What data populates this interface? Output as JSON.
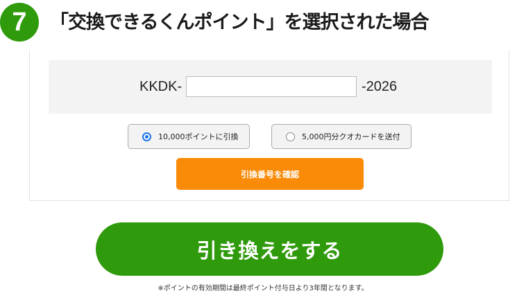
{
  "step": {
    "number": "7",
    "heading": "「交換できるくんポイント」を選択された場合"
  },
  "form": {
    "code_prefix": "KKDK-",
    "code_value": "",
    "code_placeholder": "",
    "code_suffix": "-2026",
    "options": [
      {
        "label": "10,000ポイントに引換",
        "selected": true
      },
      {
        "label": "5,000円分クオカードを送付",
        "selected": false
      }
    ],
    "confirm_label": "引換番号を確認"
  },
  "redeem_label": "引き換えをする",
  "footnote": "※ポイントの有効期間は最終ポイント付与日より3年間となります。",
  "colors": {
    "brand_green": "#2f9a0b",
    "orange": "#f98b09",
    "radio_blue": "#1a73e8"
  }
}
